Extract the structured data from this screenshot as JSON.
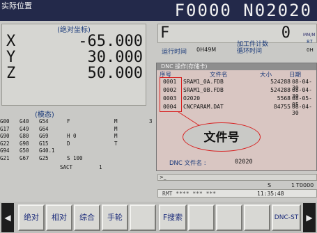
{
  "header": {
    "title": "实际位置",
    "program": "F0000 N02020"
  },
  "coords": {
    "title": "(绝对坐标)",
    "axes": [
      {
        "axis": "X",
        "value": "-65.000"
      },
      {
        "axis": "Y",
        "value": "30.000"
      },
      {
        "axis": "Z",
        "value": "50.000"
      }
    ]
  },
  "modal": {
    "title": "(模态)",
    "rows": [
      [
        "G00",
        "G40",
        "G54",
        "F",
        "M",
        "3"
      ],
      [
        "G17",
        "G49",
        "G64",
        "",
        "M",
        ""
      ],
      [
        "G90",
        "G80",
        "G69",
        "H 0",
        "M",
        ""
      ],
      [
        "G22",
        "G98",
        "G15",
        "D",
        "T",
        ""
      ],
      [
        "G94",
        "G50",
        "G40.1",
        "",
        "",
        ""
      ],
      [
        "G21",
        "G67",
        "G25",
        "S 100",
        "",
        ""
      ]
    ],
    "sact_label": "SACT",
    "sact_value": "1"
  },
  "feed": {
    "label": "F",
    "value": "0",
    "unit": "MM/M"
  },
  "counters": {
    "parts_label": "加工件计数",
    "parts_value": "87",
    "run_label": "运行时间",
    "run_value": "0H49M",
    "cycle_label": "循环时间",
    "cycle_value": "0H"
  },
  "dnc": {
    "title": "DNC 操作(存储卡)",
    "headers": {
      "no": "序号",
      "name": "文件名",
      "size": "大小",
      "date": "日期"
    },
    "files": [
      {
        "no": "0001",
        "name": "SRAM1_0A.FDB",
        "size": "524288",
        "date": "08-04-30"
      },
      {
        "no": "0002",
        "name": "SRAM1_0B.FDB",
        "size": "524288",
        "date": "08-04-30"
      },
      {
        "no": "0003",
        "name": "O2020",
        "size": "5568",
        "date": "08-05-05"
      },
      {
        "no": "0004",
        "name": "CNCPARAM.DAT",
        "size": "84755",
        "date": "08-04-30"
      }
    ],
    "filename_label": "DNC 文件名 :",
    "filename_value": "02020"
  },
  "callout": "文件号",
  "input_prompt": ">_",
  "mode": {
    "s_label": "S",
    "s_value": "1",
    "tool": "T0000"
  },
  "status": {
    "mode": "RMT **** *** ***",
    "time": "11:35:48"
  },
  "softkeys": [
    "绝对",
    "相对",
    "综合",
    "手轮",
    "",
    "F搜索",
    "",
    "",
    "",
    "DNC-ST",
    ""
  ],
  "arrows": {
    "left": "◀",
    "right": "▶"
  }
}
